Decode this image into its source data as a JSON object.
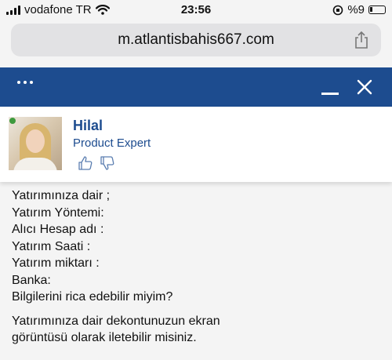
{
  "status_bar": {
    "carrier": "vodafone TR",
    "time": "23:56",
    "battery": "%9"
  },
  "browser": {
    "url": "m.atlantisbahis667.com"
  },
  "agent": {
    "name": "Hilal",
    "role": "Product Expert",
    "status_color": "#3e9a3e"
  },
  "theme": {
    "accent": "#1d4c8f"
  },
  "messages": {
    "first": [
      "Yatırımınıza dair ;",
      "Yatırım Yöntemi:",
      "Alıcı Hesap adı :",
      "Yatırım Saati :",
      "Yatırım miktarı :",
      "Banka:",
      "Bilgilerini rica edebilir miyim?"
    ],
    "second": [
      "Yatırımınıza dair dekontunuzun ekran",
      "görüntüsü olarak iletebilir misiniz."
    ]
  }
}
